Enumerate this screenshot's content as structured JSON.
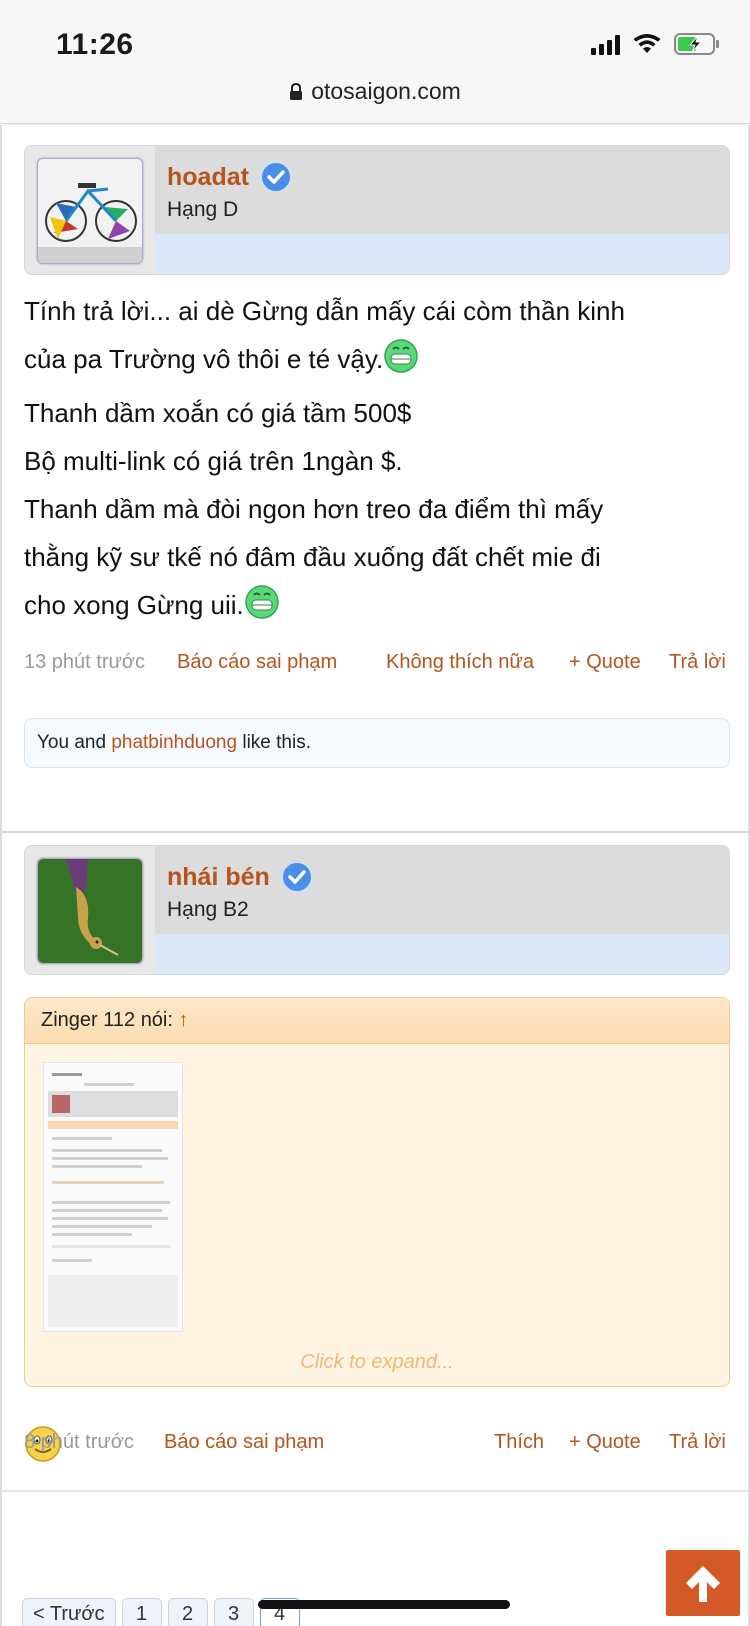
{
  "status_bar": {
    "time": "11:26"
  },
  "url_bar": {
    "domain": "otosaigon.com"
  },
  "posts": [
    {
      "username": "hoadat",
      "rank": "Hạng D",
      "message_lines": [
        "Tính trả lời... ai dè Gừng dẫn mấy cái còm thần kinh",
        "của pa Trường vô thôi e té vậy.",
        "Thanh dầm xoắn có giá tầm 500$",
        "Bộ multi-link có giá trên 1ngàn $.",
        "Thanh dầm mà đòi ngon hơn treo đa điểm thì mấy",
        "thằng kỹ sư tkế nó đâm đầu xuống đất chết mie đi",
        "cho xong Gừng uii."
      ],
      "time": "13 phút trước",
      "report": "Báo cáo sai phạm",
      "like_action": "Không thích nữa",
      "quote": "+ Quote",
      "reply": "Trả lời",
      "likes": {
        "prefix": "You and",
        "user": "phatbinhduong",
        "suffix": "like this."
      }
    },
    {
      "username": "nhái bén",
      "rank": "Hạng B2",
      "quote_block": {
        "author_text": "Zinger 112 nói:",
        "arrow": "↑",
        "expand": "Click to expand..."
      },
      "time": "8 phút trước",
      "report": "Báo cáo sai phạm",
      "like_action": "Thích",
      "quote": "+ Quote",
      "reply": "Trả lời"
    }
  ],
  "pagination": {
    "prev": "< Trước",
    "pages": [
      "1",
      "2",
      "3",
      "4"
    ],
    "current": "4"
  },
  "colors": {
    "accent": "#b5541d",
    "scroll_button": "#d35a27",
    "quote_bg": "#fff3e2"
  }
}
